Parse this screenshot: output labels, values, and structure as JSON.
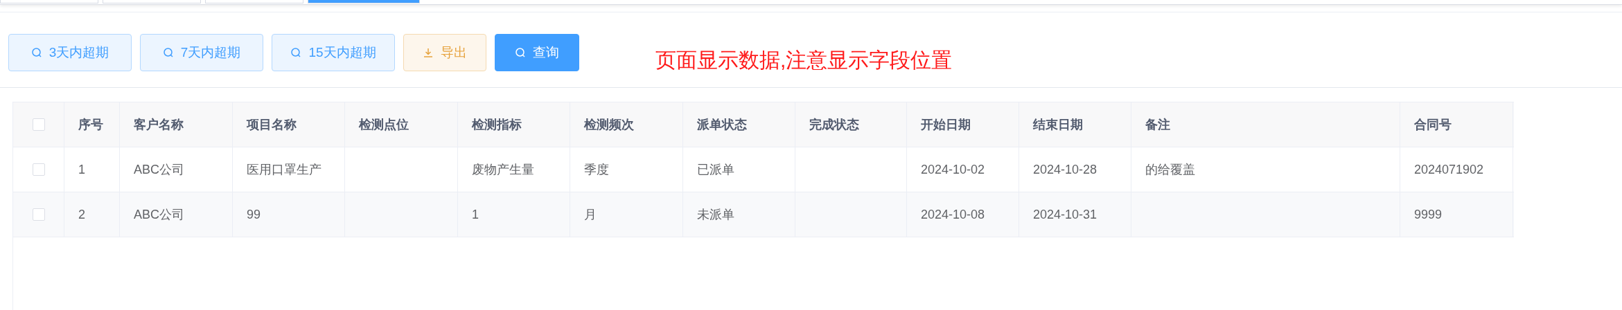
{
  "tabs": [
    {
      "selected": false
    },
    {
      "selected": false
    },
    {
      "selected": false
    },
    {
      "selected": true
    }
  ],
  "toolbar": {
    "buttons": [
      {
        "kind": "search",
        "label": "3天内超期"
      },
      {
        "kind": "search",
        "label": "7天内超期"
      },
      {
        "kind": "search",
        "label": "15天内超期"
      },
      {
        "kind": "export",
        "label": "导出"
      },
      {
        "kind": "primary",
        "label": "查询"
      }
    ],
    "annotation": "页面显示数据,注意显示字段位置"
  },
  "table": {
    "select_all": {
      "checked": false
    },
    "columns": [
      "序号",
      "客户名称",
      "项目名称",
      "检测点位",
      "检测指标",
      "检测频次",
      "派单状态",
      "完成状态",
      "开始日期",
      "结束日期",
      "备注",
      "合同号"
    ],
    "rows": [
      {
        "checked": false,
        "cells": [
          "1",
          "ABC公司",
          "医用口罩生产",
          "",
          "废物产生量",
          "季度",
          "已派单",
          "",
          "2024-10-02",
          "2024-10-28",
          "的给覆盖",
          "2024071902"
        ]
      },
      {
        "checked": false,
        "cells": [
          "2",
          "ABC公司",
          "99",
          "",
          "1",
          "月",
          "未派单",
          "",
          "2024-10-08",
          "2024-10-31",
          "",
          "9999"
        ]
      }
    ]
  }
}
